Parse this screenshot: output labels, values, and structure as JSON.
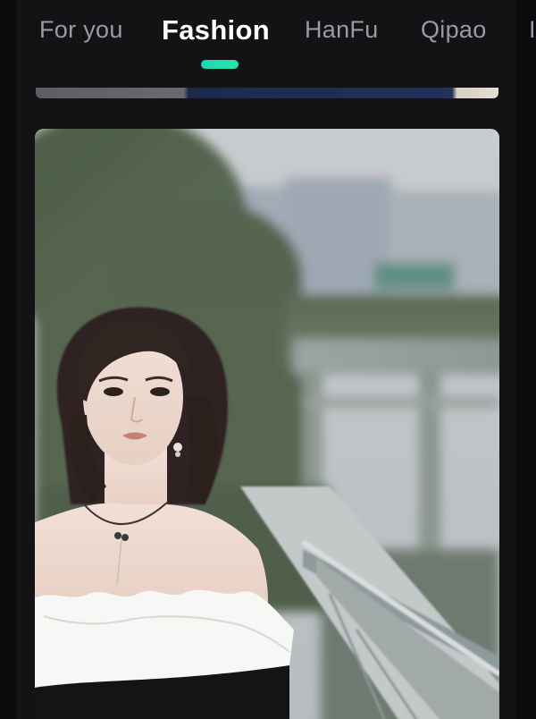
{
  "tabs": {
    "items": [
      {
        "label": "For you",
        "active": false
      },
      {
        "label": "Fashion",
        "active": true
      },
      {
        "label": "HanFu",
        "active": false
      },
      {
        "label": "Qipao",
        "active": false
      },
      {
        "label": "I",
        "active": false
      }
    ],
    "indicator_color": "#1fd6b8"
  },
  "feed": {
    "cards": [
      {
        "type": "video",
        "subject": "woman-portrait-on-bridge"
      }
    ]
  },
  "colors": {
    "background": "#131316",
    "active_tab": "#ffffff",
    "inactive_tab": "#9a9aa0"
  }
}
